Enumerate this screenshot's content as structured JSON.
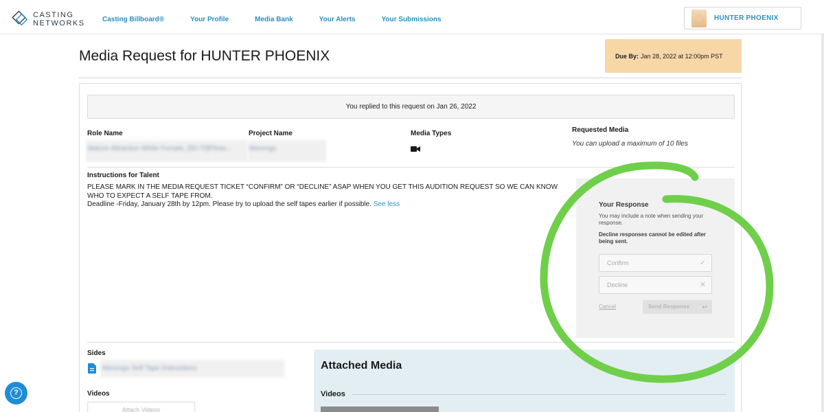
{
  "brand": {
    "line1": "CASTING",
    "line2": "NETWORKS",
    "accent_color": "#2a8fbf"
  },
  "nav": {
    "items": [
      {
        "label": "Casting Billboard®"
      },
      {
        "label": "Your Profile"
      },
      {
        "label": "Media Bank"
      },
      {
        "label": "Your Alerts"
      },
      {
        "label": "Your Submissions"
      }
    ],
    "user_name": "HUNTER PHOENIX"
  },
  "header": {
    "title": "Media Request for HUNTER PHOENIX",
    "due_label": "Due By:",
    "due_value": "Jan 28, 2022 at 12:00pm PST",
    "due_color": "#f8d7a7"
  },
  "request": {
    "replied_text": "You replied to this request on Jan 26, 2022",
    "role_name_label": "Role Name",
    "role_name_value": "Mature Attractive White Female, [50-70]Pleas...",
    "project_name_label": "Project Name",
    "project_name_value": "Merengo",
    "media_types_label": "Media Types",
    "media_types_icon": "video-camera-icon",
    "requested_media_label": "Requested Media",
    "requested_media_note": "You can upload a maximum of 10 files",
    "instructions_label": "Instructions for Talent",
    "instructions_line1": "PLEASE MARK IN THE MEDIA REQUEST TICKET “CONFIRM” OR “DECLINE” ASAP WHEN YOU GET THIS AUDITION REQUEST SO WE CAN KNOW WHO TO EXPECT A SELF TAPE FROM.",
    "instructions_line2": "Deadline -Friday, January 28th by 12pm. Please try to upload the self tapes earlier if possible.",
    "see_less": "See less"
  },
  "response_panel": {
    "title": "Your Response",
    "note": "You may include a note when sending your response.",
    "warning": "Decline responses cannot be edited after being sent.",
    "options": [
      {
        "label": "Confirm",
        "icon": "check-icon",
        "mark": "✓"
      },
      {
        "label": "Decline",
        "icon": "x-icon",
        "mark": "✕"
      }
    ],
    "cancel_label": "Cancel",
    "send_label": "Send Response",
    "highlight_color": "#6fcf4a"
  },
  "sides": {
    "label": "Sides",
    "file_name": "Merengo Self Tape Instructions",
    "file_icon": "document-icon"
  },
  "videos": {
    "label": "Videos",
    "attach_label": "Attach Videos"
  },
  "attached_media": {
    "title": "Attached Media",
    "videos_label": "Videos"
  },
  "help": {
    "icon": "question-icon",
    "glyph": "?"
  }
}
